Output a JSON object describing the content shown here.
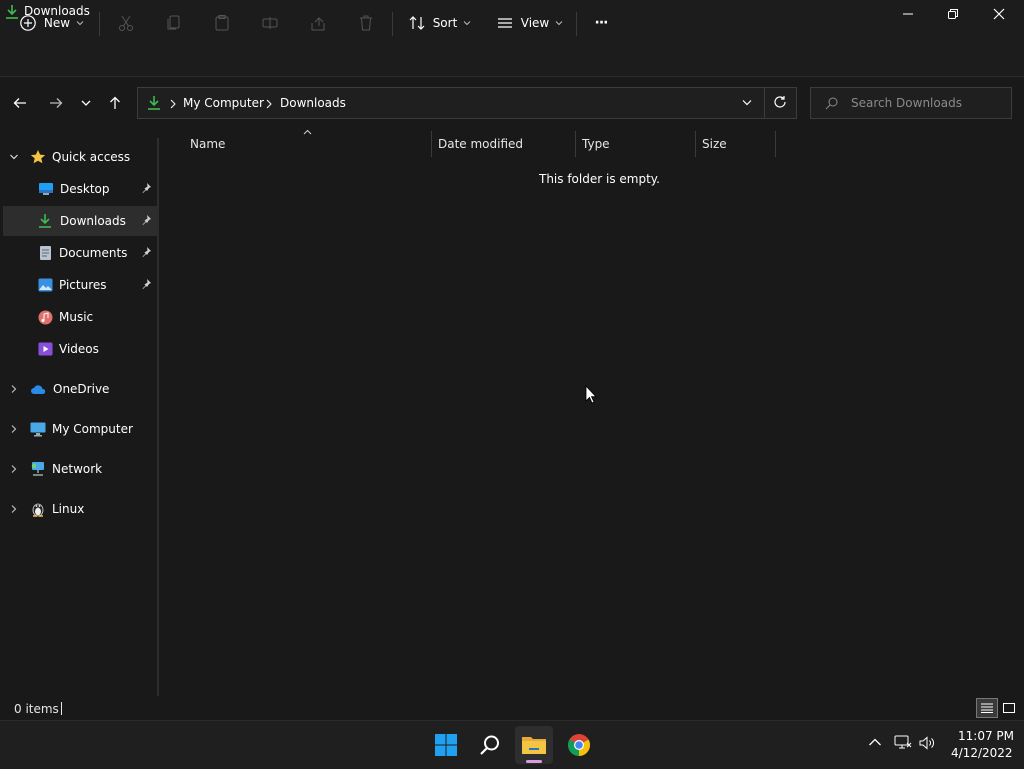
{
  "window": {
    "title": "Downloads"
  },
  "toolbar": {
    "new_label": "New",
    "sort_label": "Sort",
    "view_label": "View",
    "more_label": "···"
  },
  "address": {
    "crumbs": [
      "My Computer",
      "Downloads"
    ],
    "search_placeholder": "Search Downloads"
  },
  "nav": {
    "quick_access": "Quick access",
    "items": [
      {
        "label": "Desktop",
        "icon": "desktop-icon"
      },
      {
        "label": "Downloads",
        "icon": "download-icon"
      },
      {
        "label": "Documents",
        "icon": "document-icon"
      },
      {
        "label": "Pictures",
        "icon": "pictures-icon"
      },
      {
        "label": "Music",
        "icon": "music-icon"
      },
      {
        "label": "Videos",
        "icon": "videos-icon"
      }
    ],
    "sections": [
      {
        "label": "OneDrive",
        "icon": "onedrive-icon"
      },
      {
        "label": "My Computer",
        "icon": "computer-icon"
      },
      {
        "label": "Network",
        "icon": "network-icon"
      },
      {
        "label": "Linux",
        "icon": "linux-icon"
      }
    ]
  },
  "content": {
    "columns": [
      "Name",
      "Date modified",
      "Type",
      "Size"
    ],
    "empty_message": "This folder is empty."
  },
  "status": {
    "item_count": "0 items"
  },
  "taskbar": {
    "time": "11:07 PM",
    "date": "4/12/2022"
  },
  "colors": {
    "accent_green": "#3fb950",
    "folder_yellow": "#f4c542",
    "windows_blue": "#1fa0f0",
    "selected_bg": "#2d2d2d"
  }
}
